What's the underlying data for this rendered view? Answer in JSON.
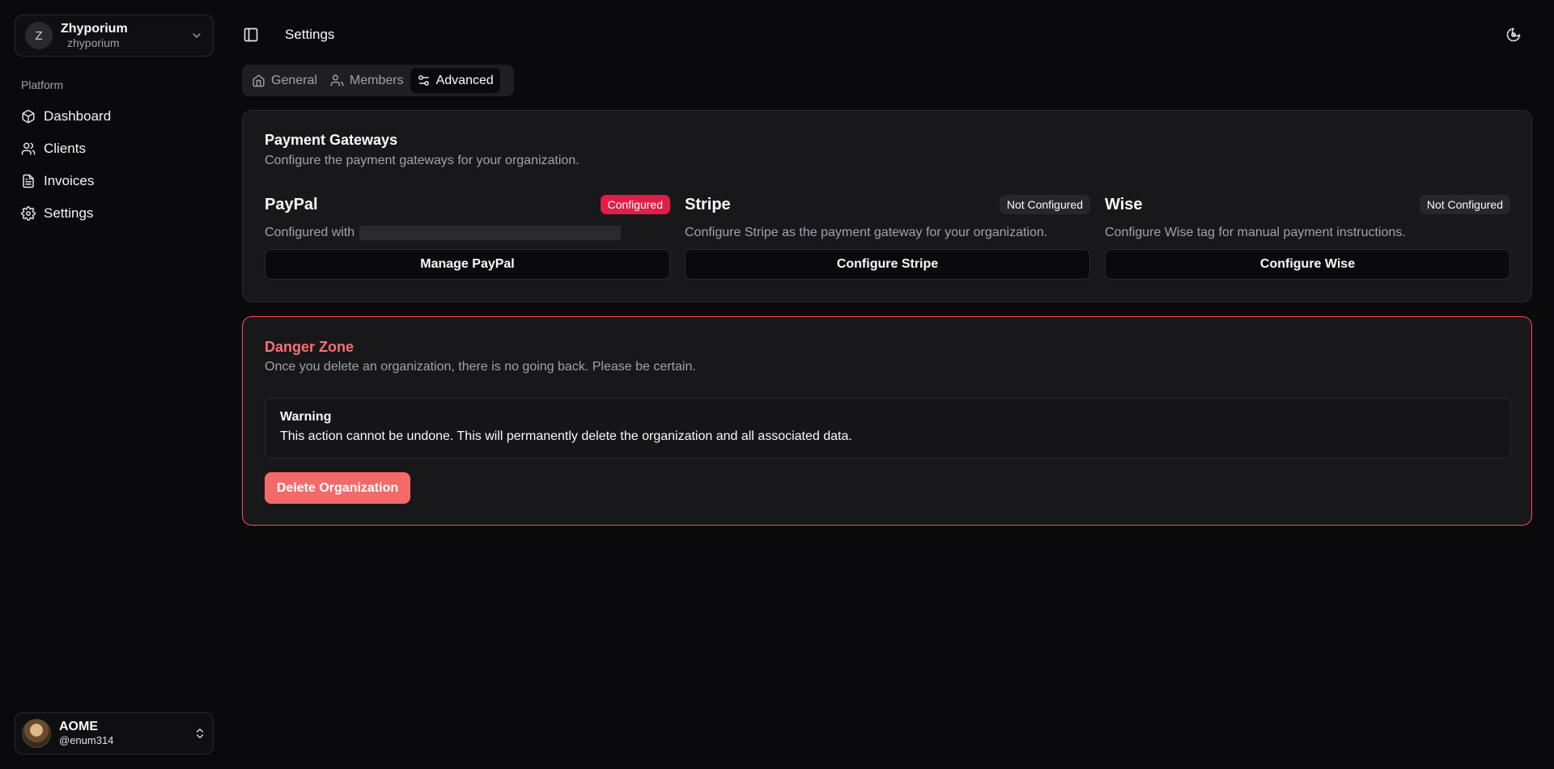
{
  "org": {
    "initial": "Z",
    "name": "Zhyporium",
    "slug": "zhyporium"
  },
  "sidebar": {
    "group_label": "Platform",
    "items": [
      {
        "label": "Dashboard",
        "icon": "box-icon"
      },
      {
        "label": "Clients",
        "icon": "users-icon"
      },
      {
        "label": "Invoices",
        "icon": "file-text-icon"
      },
      {
        "label": "Settings",
        "icon": "gear-icon"
      }
    ]
  },
  "user": {
    "name": "AOME",
    "handle": "@enum314"
  },
  "header": {
    "title": "Settings"
  },
  "tabs": [
    {
      "label": "General",
      "icon": "home-icon"
    },
    {
      "label": "Members",
      "icon": "user-icon"
    },
    {
      "label": "Advanced",
      "icon": "sliders-icon",
      "active": true
    }
  ],
  "gateways": {
    "title": "Payment Gateways",
    "description": "Configure the payment gateways for your organization.",
    "items": [
      {
        "name": "PayPal",
        "status": "Configured",
        "description": "Configured with",
        "button": "Manage PayPal"
      },
      {
        "name": "Stripe",
        "status": "Not Configured",
        "description": "Configure Stripe as the payment gateway for your organization.",
        "button": "Configure Stripe"
      },
      {
        "name": "Wise",
        "status": "Not Configured",
        "description": "Configure Wise tag for manual payment instructions.",
        "button": "Configure Wise"
      }
    ]
  },
  "danger": {
    "title": "Danger Zone",
    "description": "Once you delete an organization, there is no going back. Please be certain.",
    "warning_title": "Warning",
    "warning_text": "This action cannot be undone. This will permanently delete the organization and all associated data.",
    "delete_button": "Delete Organization"
  },
  "colors": {
    "background": "#0a0a0c",
    "card": "#18181b",
    "configured_badge": "#e11d48",
    "danger": "#f87171",
    "delete_button": "#f46a6a"
  }
}
